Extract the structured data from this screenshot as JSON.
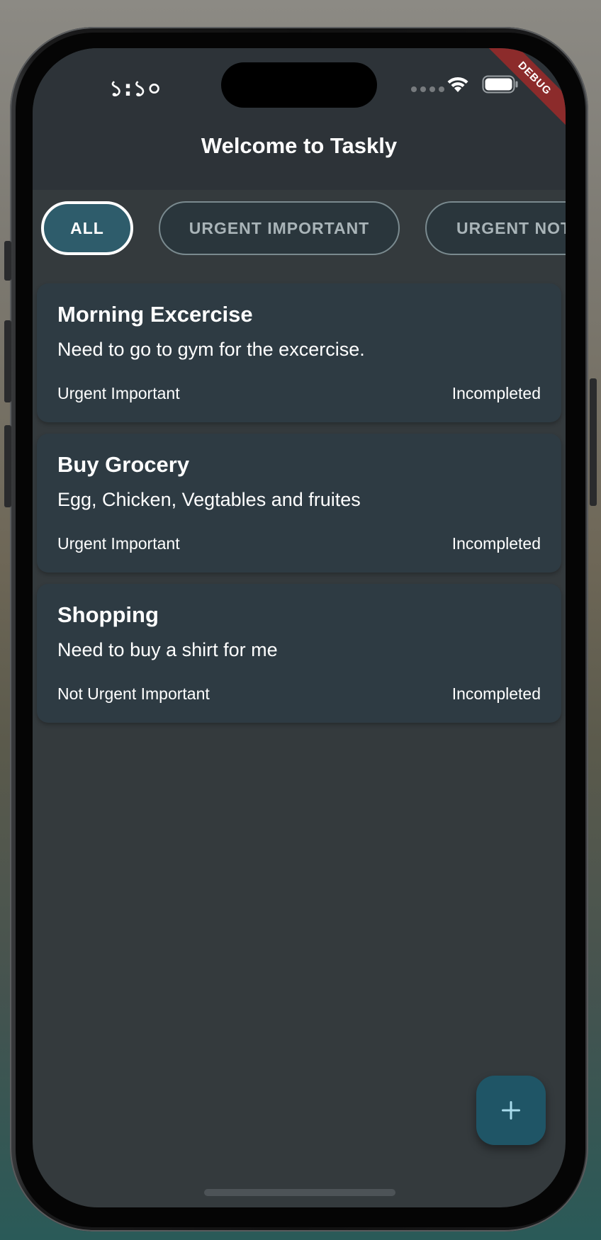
{
  "status_bar": {
    "time": "১:১০",
    "wifi_icon": "wifi-icon",
    "battery_icon": "battery-icon",
    "debug_label": "DEBUG"
  },
  "app_bar": {
    "title": "Welcome to Taskly"
  },
  "filters": [
    {
      "label": "ALL",
      "active": true
    },
    {
      "label": "URGENT IMPORTANT",
      "active": false
    },
    {
      "label": "URGENT NOT",
      "active": false
    }
  ],
  "tasks": [
    {
      "title": "Morning Excercise",
      "description": "Need to go to gym for the excercise.",
      "priority": "Urgent Important",
      "status": "Incompleted"
    },
    {
      "title": "Buy Grocery",
      "description": "Egg, Chicken, Vegtables and fruites",
      "priority": "Urgent Important",
      "status": "Incompleted"
    },
    {
      "title": "Shopping",
      "description": "Need to buy a shirt for me",
      "priority": "Not Urgent Important",
      "status": "Incompleted"
    }
  ],
  "fab": {
    "icon": "plus-icon"
  },
  "colors": {
    "background": "#343a3d",
    "app_bar": "#2d3338",
    "card": "#2e3b43",
    "chip_active": "#2e5c6b",
    "fab": "#1f5566",
    "fab_icon": "#a8dcec"
  }
}
